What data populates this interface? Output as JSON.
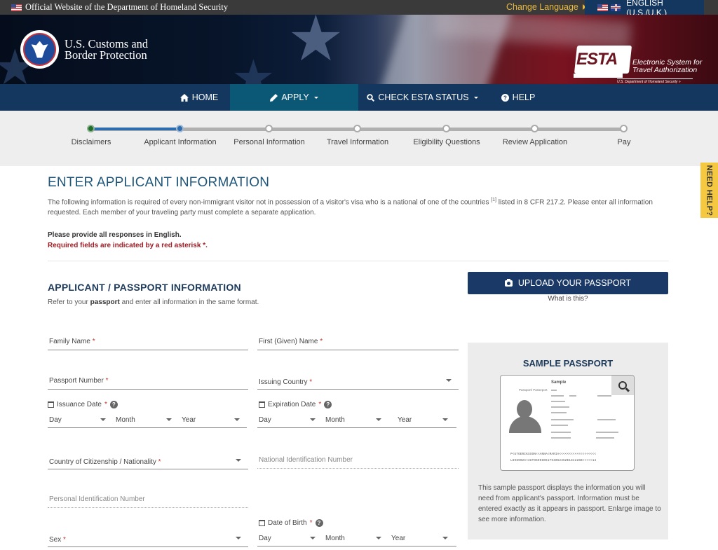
{
  "topbar": {
    "official_text": "Official Website of the Department of Homeland Security",
    "change_language": "Change Language",
    "language": "ENGLISH (U.S./U.K.)"
  },
  "banner": {
    "agency_line1": "U.S. Customs and",
    "agency_line2": "Border Protection",
    "esta_word": "ESTA",
    "esta_line1": "Electronic System for",
    "esta_line2": "Travel Authorization",
    "esta_sub": "U.S. Department of Homeland Security »"
  },
  "nav": {
    "items": [
      {
        "label": "HOME",
        "icon": "home-icon",
        "active": false
      },
      {
        "label": "APPLY",
        "icon": "pencil-icon",
        "active": true,
        "dropdown": true
      },
      {
        "label": "CHECK ESTA STATUS",
        "icon": "search-icon",
        "active": false,
        "dropdown": true
      },
      {
        "label": "HELP",
        "icon": "help-circle-icon",
        "active": false
      }
    ]
  },
  "progress": {
    "steps": [
      {
        "label": "Disclaimers",
        "state": "done"
      },
      {
        "label": "Applicant Information",
        "state": "current"
      },
      {
        "label": "Personal Information",
        "state": "todo"
      },
      {
        "label": "Travel Information",
        "state": "todo"
      },
      {
        "label": "Eligibility Questions",
        "state": "todo"
      },
      {
        "label": "Review Application",
        "state": "todo"
      },
      {
        "label": "Pay",
        "state": "todo"
      }
    ]
  },
  "need_help": "NEED HELP?",
  "page": {
    "title": "ENTER APPLICANT INFORMATION",
    "intro_part1": "The following information is required of every non-immigrant visitor not in possession of a visitor's visa who is a national of one of the countries ",
    "intro_footnote": "[1]",
    "intro_part2": " listed in 8 CFR 217.2. Please enter all information requested. Each member of your traveling party must complete a separate application.",
    "english_note": "Please provide all responses in English.",
    "required_note": "Required fields are indicated by a red asterisk *."
  },
  "section": {
    "title": "APPLICANT / PASSPORT INFORMATION",
    "sub_prefix": "Refer to your ",
    "sub_bold": "passport",
    "sub_suffix": " and enter all information in the same format."
  },
  "upload": {
    "button_label": "UPLOAD YOUR PASSPORT",
    "what_is_this": "What is this?"
  },
  "fields": {
    "family_name": {
      "label": "Family Name",
      "required": "*",
      "value": ""
    },
    "first_name": {
      "label": "First (Given) Name",
      "required": "*",
      "value": ""
    },
    "passport_number": {
      "label": "Passport Number",
      "required": "*",
      "value": ""
    },
    "issuing_country": {
      "label": "Issuing Country",
      "required": "*",
      "value": ""
    },
    "issuance_date": {
      "label": "Issuance Date",
      "required": "*",
      "day": "Day",
      "month": "Month",
      "year": "Year"
    },
    "expiration_date": {
      "label": "Expiration Date",
      "required": "*",
      "day": "Day",
      "month": "Month",
      "year": "Year"
    },
    "citizenship": {
      "label": "Country of Citizenship / Nationality",
      "required": "*",
      "value": ""
    },
    "national_id": {
      "placeholder": "National Identification Number"
    },
    "personal_id": {
      "placeholder": "Personal Identification Number"
    },
    "sex": {
      "label": "Sex",
      "required": "*",
      "value": ""
    },
    "date_of_birth": {
      "label": "Date of Birth",
      "required": "*",
      "day": "Day",
      "month": "Month",
      "year": "Year"
    }
  },
  "sample": {
    "title": "SAMPLE PASSPORT",
    "pp_label": "Passport/ Passeport",
    "pp_sample": "Sample",
    "mrz1": "P<UTOERIKSSON<<ANNA<MARIA<<<<<<<<<<<<<<<<<<<",
    "mrz2": "L898902C<3UTO6908061F9406236ZE184226B<<<<<14",
    "description": "This sample passport displays the information you will need from applicant's passport. Information must be entered exactly as it appears in passport. Enlarge image to see more information."
  }
}
